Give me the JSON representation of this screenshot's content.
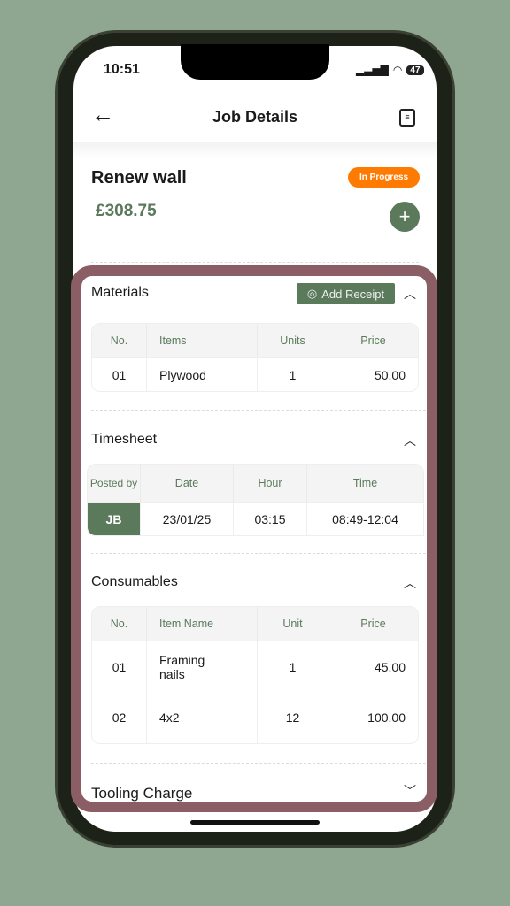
{
  "status": {
    "time": "10:51",
    "battery": "47"
  },
  "header": {
    "title": "Job Details",
    "back_icon": "arrow-left-icon",
    "receipt_icon": "receipt-icon"
  },
  "job": {
    "title": "Renew wall",
    "price": "£308.75",
    "status": "In Progress",
    "status_color": "#ff7a00",
    "add": "+"
  },
  "accent": "#5b7a5c",
  "materials": {
    "title": "Materials",
    "add_receipt": "Add Receipt",
    "headers": [
      "No.",
      "Items",
      "Units",
      "Price"
    ],
    "rows": [
      [
        "01",
        "Plywood",
        "1",
        "50.00"
      ]
    ]
  },
  "timesheet": {
    "title": "Timesheet",
    "headers": [
      "Posted by",
      "Date",
      "Hour",
      "Time"
    ],
    "rows": [
      [
        "JB",
        "23/01/25",
        "03:15",
        "08:49-12:04"
      ]
    ]
  },
  "consumables": {
    "title": "Consumables",
    "headers": [
      "No.",
      "Item Name",
      "Unit",
      "Price"
    ],
    "rows": [
      [
        "01",
        "Framing nails",
        "1",
        "45.00"
      ],
      [
        "02",
        "4x2",
        "12",
        "100.00"
      ]
    ]
  },
  "tooling": {
    "title": "Tooling Charge"
  }
}
